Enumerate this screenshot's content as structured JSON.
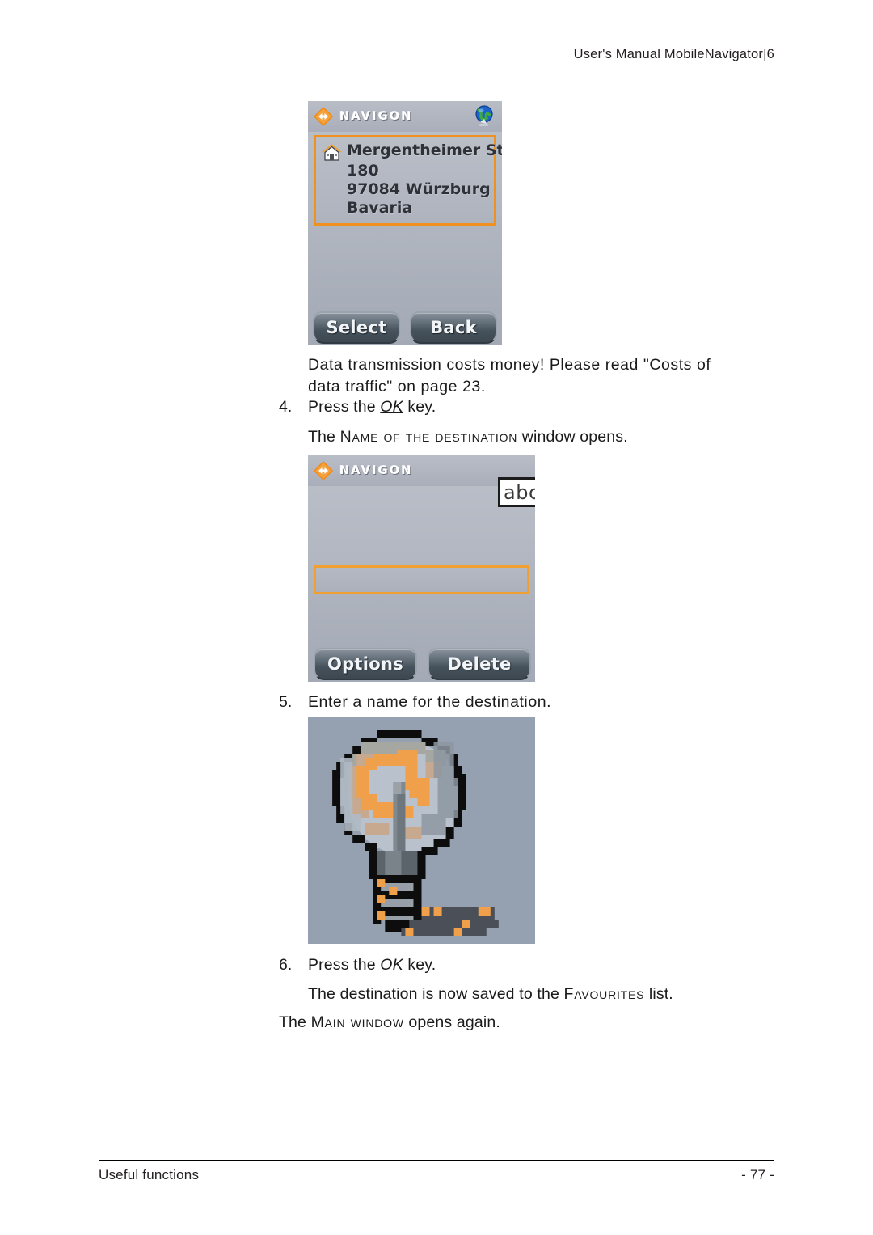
{
  "header": {
    "title": "User's Manual MobileNavigator|6"
  },
  "screenshot_address": {
    "name": "destination-address-screen",
    "brand": "NAVIGON",
    "brand_icon": "navigon-diamond-icon",
    "globe_icon": "globe-on-stand-icon",
    "house_icon": "house-icon",
    "address": {
      "street": "Mergentheimer Straße",
      "number": "180",
      "postcode_city": "97084 Würzburg",
      "region": "Bavaria"
    },
    "buttons": {
      "left": "Select",
      "right": "Back"
    }
  },
  "note": {
    "text": "Data transmission costs money! Please read \"Costs of data traffic\" on page 23."
  },
  "steps": [
    {
      "number": "4.",
      "text_before": "Press the ",
      "key": "OK",
      "text_after": " key.",
      "result_before": "The ",
      "result_caps": "Name of the destination",
      "result_after": " window opens."
    },
    {
      "number": "5.",
      "text": "Enter a name for the destination."
    },
    {
      "number": "6.",
      "text_before": "Press the ",
      "key": "OK",
      "text_after": " key.",
      "result_before": "The destination is now saved to the ",
      "result_caps": "Favourites",
      "result_after": " list."
    }
  ],
  "final_note": {
    "before": "The ",
    "caps": "Main window",
    "after": " opens again."
  },
  "screenshot_name_entry": {
    "name": "name-of-destination-screen",
    "brand": "NAVIGON",
    "brand_icon": "navigon-diamond-icon",
    "input_mode_badge": "abc",
    "input_value": "",
    "buttons": {
      "left": "Options",
      "right": "Delete"
    }
  },
  "bulb_image": {
    "name": "light-bulb-tip-graphic",
    "alt": "pixelated light bulb illustration",
    "background_color": "#95a0b0",
    "bulb_glass_color": "#b9c2cc",
    "filament_color": "#f0a04b",
    "outline_color": "#101010",
    "shadow_color": "#4b5058"
  },
  "footer": {
    "left": "Useful functions",
    "right": "- 77 -"
  },
  "colors": {
    "accent_orange": "#f0901e",
    "screen_gray": "#b2b7c1",
    "button_dark": "#46525c"
  }
}
